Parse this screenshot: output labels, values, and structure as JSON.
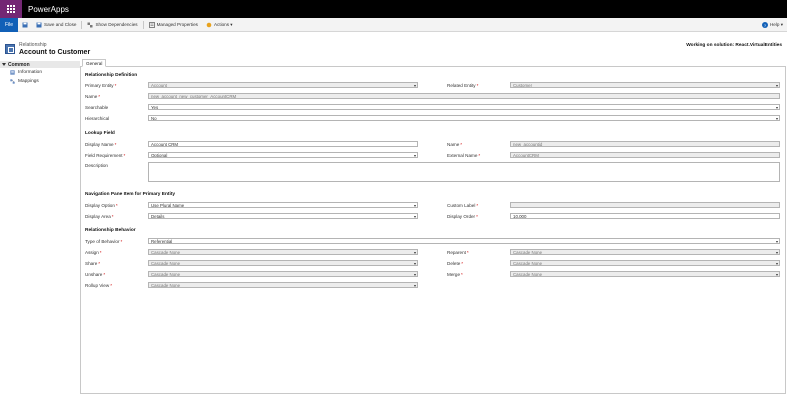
{
  "app": {
    "title": "PowerApps"
  },
  "ribbon": {
    "file": "File",
    "save_close": "Save and Close",
    "show_dependencies": "Show Dependencies",
    "managed_properties": "Managed Properties",
    "actions": "Actions ▾",
    "help": "Help ▾"
  },
  "record": {
    "type": "Relationship",
    "title": "Account to Customer",
    "solution": "Working on solution: React.VirtualEntities"
  },
  "nav": {
    "section": "Common",
    "items": [
      "Information",
      "Mappings"
    ]
  },
  "tab": "General",
  "sections": {
    "definition": "Relationship Definition",
    "lookup": "Lookup Field",
    "navigation": "Navigation Pane Item for Primary Entity",
    "behavior": "Relationship Behavior"
  },
  "definition": {
    "primary_entity": {
      "label": "Primary Entity",
      "value": "Account"
    },
    "related_entity": {
      "label": "Related Entity",
      "value": "Customer"
    },
    "name": {
      "label": "Name",
      "value": "new_account_new_customer_AccountCRM"
    },
    "searchable": {
      "label": "Searchable",
      "value": "Yes"
    },
    "hierarchical": {
      "label": "Hierarchical",
      "value": "No"
    }
  },
  "lookup": {
    "display_name": {
      "label": "Display Name",
      "value": "Account CRM"
    },
    "name": {
      "label": "Name",
      "value": "new_accountid"
    },
    "field_requirement": {
      "label": "Field Requirement",
      "value": "Optional"
    },
    "external_name": {
      "label": "External Name",
      "value": "AccountCRM"
    },
    "description": {
      "label": "Description",
      "value": ""
    }
  },
  "navigation": {
    "display_option": {
      "label": "Display Option",
      "value": "Use Plural Name"
    },
    "custom_label": {
      "label": "Custom Label",
      "value": ""
    },
    "display_area": {
      "label": "Display Area",
      "value": "Details"
    },
    "display_order": {
      "label": "Display Order",
      "value": "10,000"
    }
  },
  "behavior": {
    "type": {
      "label": "Type of Behavior",
      "value": "Referential"
    },
    "assign": {
      "label": "Assign",
      "value": "Cascade None"
    },
    "reparent": {
      "label": "Reparent",
      "value": "Cascade None"
    },
    "share": {
      "label": "Share",
      "value": "Cascade None"
    },
    "delete": {
      "label": "Delete",
      "value": "Cascade None"
    },
    "unshare": {
      "label": "Unshare",
      "value": "Cascade None"
    },
    "merge": {
      "label": "Merge",
      "value": "Cascade None"
    },
    "rollup": {
      "label": "Rollup View",
      "value": "Cascade None"
    }
  },
  "required_marker": "*",
  "colors": {
    "brand": "#742774",
    "file": "#1160b7",
    "header": "#000000"
  }
}
